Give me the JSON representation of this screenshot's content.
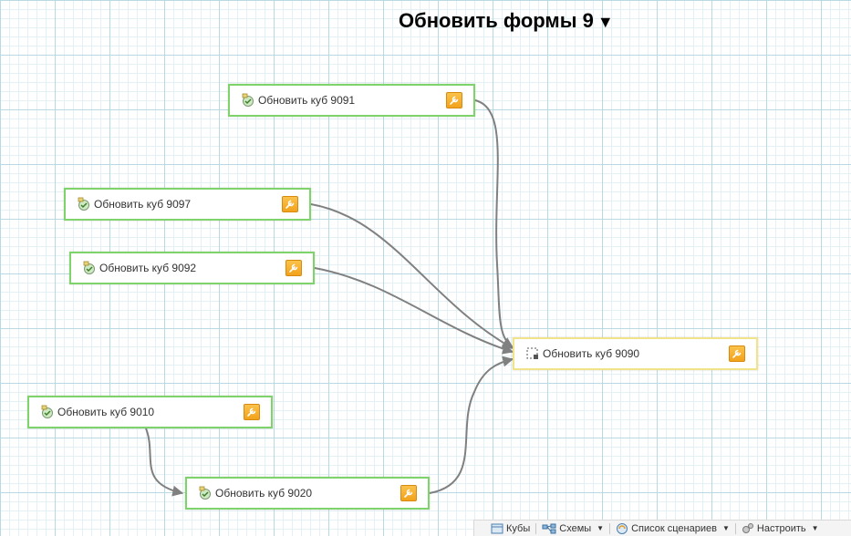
{
  "title": {
    "text": "Обновить формы 9",
    "caret": "▼"
  },
  "nodes": [
    {
      "id": "n9091",
      "label": "Обновить куб 9091"
    },
    {
      "id": "n9097",
      "label": "Обновить куб 9097"
    },
    {
      "id": "n9092",
      "label": "Обновить куб 9092"
    },
    {
      "id": "n9010",
      "label": "Обновить куб 9010"
    },
    {
      "id": "n9020",
      "label": "Обновить куб 9020"
    },
    {
      "id": "n9090",
      "label": "Обновить куб 9090"
    }
  ],
  "edges": [
    {
      "from": "Обновить куб 9091",
      "to": "Обновить куб 9090"
    },
    {
      "from": "Обновить куб 9097",
      "to": "Обновить куб 9090"
    },
    {
      "from": "Обновить куб 9092",
      "to": "Обновить куб 9090"
    },
    {
      "from": "Обновить куб 9020",
      "to": "Обновить куб 9090"
    },
    {
      "from": "Обновить куб 9010",
      "to": "Обновить куб 9020"
    }
  ],
  "toolbar": {
    "cubes": "Кубы",
    "schemes": "Схемы",
    "scenarios": "Список сценариев",
    "settings": "Настроить",
    "arrow": "▼"
  },
  "colors": {
    "node_border": "#7ed36b",
    "target_border": "#f0e38a",
    "wrench": "#f3a21b",
    "edge": "#808080",
    "grid": "#b9d9e3"
  }
}
